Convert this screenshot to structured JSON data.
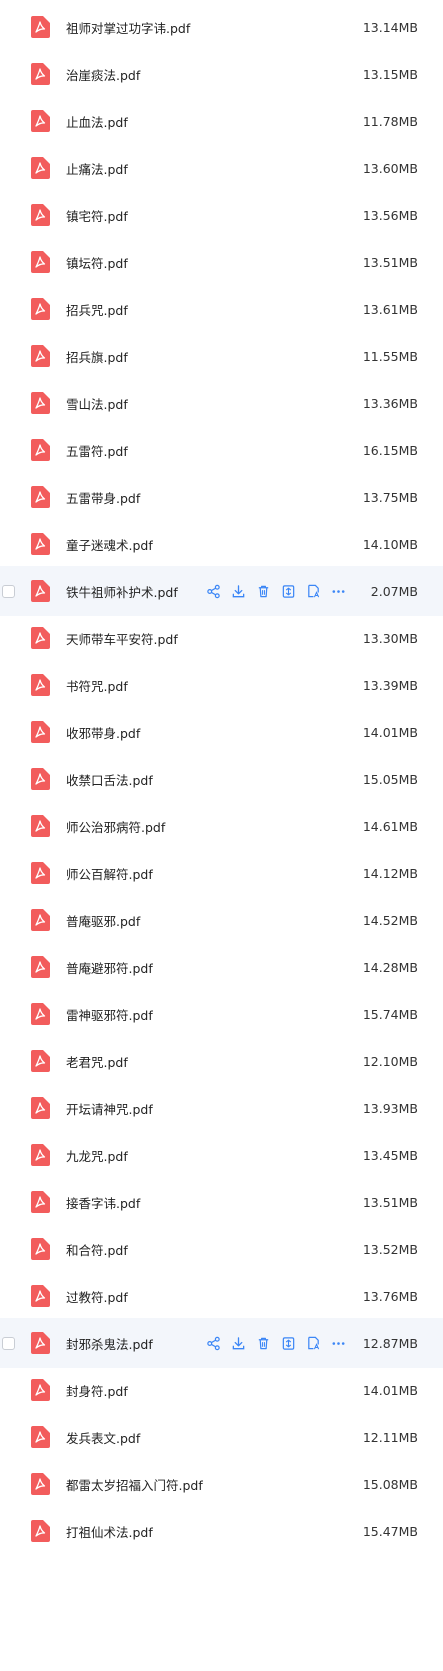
{
  "files": [
    {
      "name": "祖师对掌过功字讳.pdf",
      "size": "13.14MB"
    },
    {
      "name": "治崖痰法.pdf",
      "size": "13.15MB"
    },
    {
      "name": "止血法.pdf",
      "size": "11.78MB"
    },
    {
      "name": "止痛法.pdf",
      "size": "13.60MB"
    },
    {
      "name": "镇宅符.pdf",
      "size": "13.56MB"
    },
    {
      "name": "镇坛符.pdf",
      "size": "13.51MB"
    },
    {
      "name": "招兵咒.pdf",
      "size": "13.61MB"
    },
    {
      "name": "招兵旗.pdf",
      "size": "11.55MB"
    },
    {
      "name": "雪山法.pdf",
      "size": "13.36MB"
    },
    {
      "name": "五雷符.pdf",
      "size": "16.15MB"
    },
    {
      "name": "五雷带身.pdf",
      "size": "13.75MB"
    },
    {
      "name": "童子迷魂术.pdf",
      "size": "14.10MB"
    },
    {
      "name": "铁牛祖师补护术.pdf",
      "size": "2.07MB"
    },
    {
      "name": "天师带车平安符.pdf",
      "size": "13.30MB"
    },
    {
      "name": "书符咒.pdf",
      "size": "13.39MB"
    },
    {
      "name": "收邪带身.pdf",
      "size": "14.01MB"
    },
    {
      "name": "收禁口舌法.pdf",
      "size": "15.05MB"
    },
    {
      "name": "师公治邪病符.pdf",
      "size": "14.61MB"
    },
    {
      "name": "师公百解符.pdf",
      "size": "14.12MB"
    },
    {
      "name": "普庵驱邪.pdf",
      "size": "14.52MB"
    },
    {
      "name": "普庵避邪符.pdf",
      "size": "14.28MB"
    },
    {
      "name": "雷神驱邪符.pdf",
      "size": "15.74MB"
    },
    {
      "name": "老君咒.pdf",
      "size": "12.10MB"
    },
    {
      "name": "开坛请神咒.pdf",
      "size": "13.93MB"
    },
    {
      "name": "九龙咒.pdf",
      "size": "13.45MB"
    },
    {
      "name": "接香字讳.pdf",
      "size": "13.51MB"
    },
    {
      "name": "和合符.pdf",
      "size": "13.52MB"
    },
    {
      "name": "过教符.pdf",
      "size": "13.76MB"
    },
    {
      "name": "封邪杀鬼法.pdf",
      "size": "12.87MB"
    },
    {
      "name": "封身符.pdf",
      "size": "14.01MB"
    },
    {
      "name": "发兵表文.pdf",
      "size": "12.11MB"
    },
    {
      "name": "都雷太岁招福入门符.pdf",
      "size": "15.08MB"
    },
    {
      "name": "打祖仙术法.pdf",
      "size": "15.47MB"
    }
  ],
  "hover_rows": [
    12,
    28
  ],
  "row_actions": [
    "share-icon",
    "download-icon",
    "delete-icon",
    "extract-icon",
    "convert-icon",
    "more-icon"
  ],
  "colors": {
    "pdf_icon": "#f25c5c",
    "action": "#3b86f6",
    "hover_bg": "#f3f6fb"
  }
}
